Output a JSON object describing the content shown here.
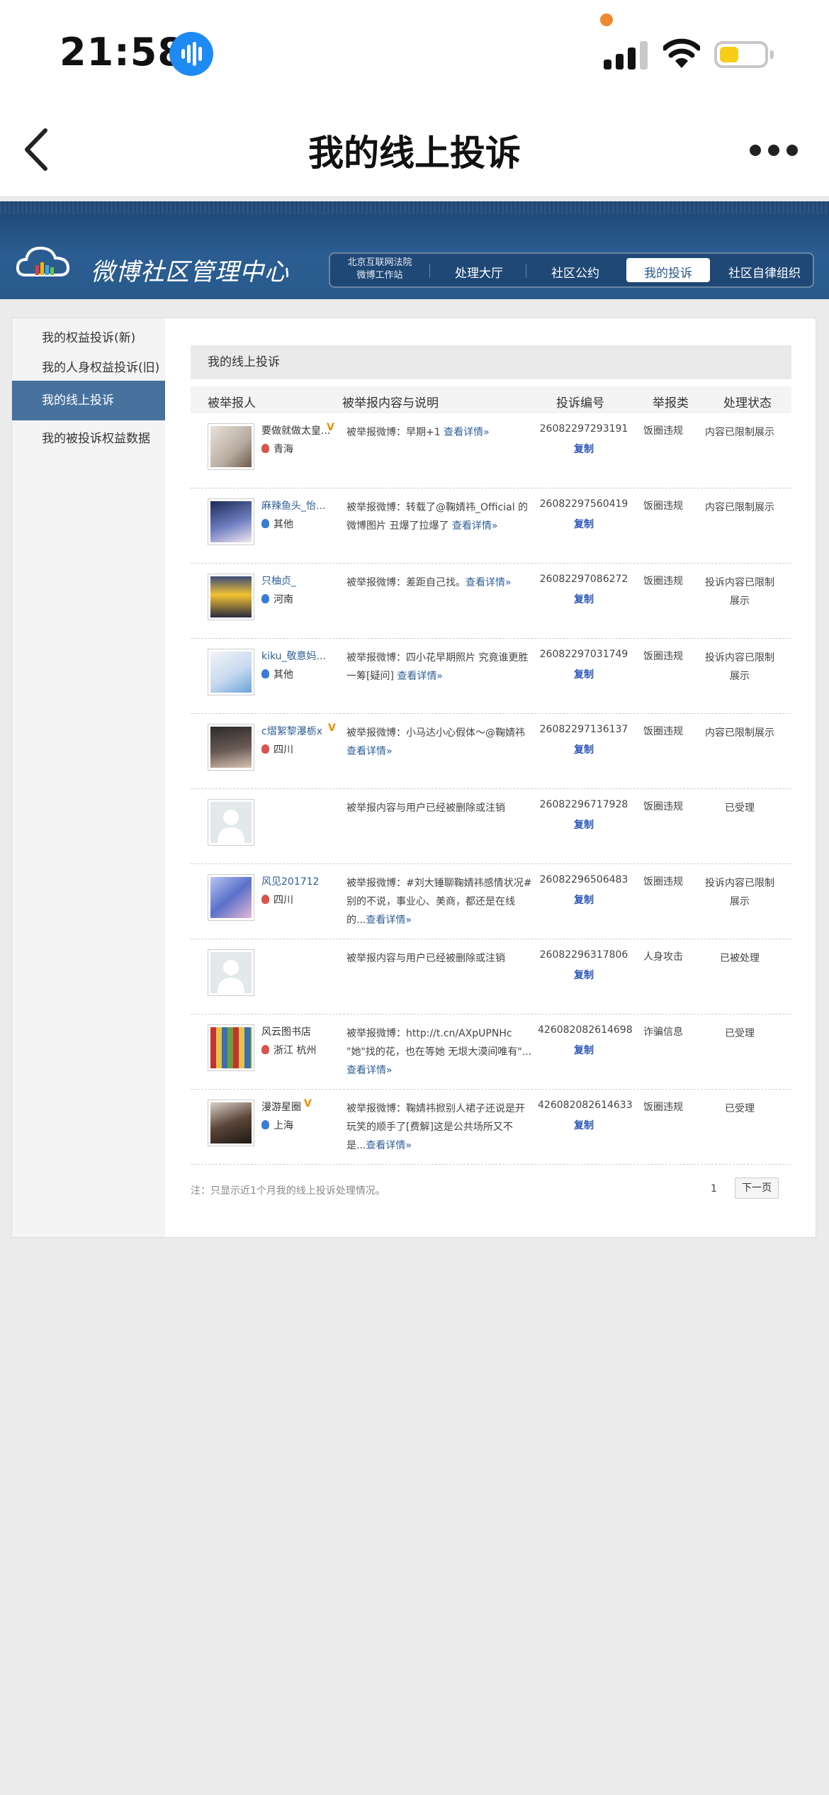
{
  "status_bar": {
    "time": "21:58"
  },
  "nav": {
    "title": "我的线上投诉"
  },
  "banner": {
    "logo_text": "微博社区管理中心",
    "court_line1": "北京互联网法院",
    "court_line2": "微博工作站",
    "menu": [
      "处理大厅",
      "社区公约",
      "我的投诉",
      "社区自律组织"
    ]
  },
  "sidebar": {
    "items": [
      "我的权益投诉(新)",
      "我的人身权益投诉(旧)",
      "我的线上投诉",
      "我的被投诉权益数据"
    ]
  },
  "main": {
    "section_title": "我的线上投诉",
    "columns": [
      "被举报人",
      "被举报内容与说明",
      "投诉编号",
      "举报类",
      "处理状态"
    ],
    "copy_label": "复制",
    "rows": [
      {
        "name": "要做就做太皇...",
        "location": "青海",
        "desc": "被举报微博：早期+1 ",
        "more": "查看详情»",
        "id": "26082297293191",
        "category": "饭圈违规",
        "status": "内容已限制展示"
      },
      {
        "name": "麻辣鱼头_怡...",
        "location": "其他",
        "desc": "被举报微博：转载了@鞠婧祎_Official 的微博图片 丑爆了拉爆了 ",
        "more": "查看详情»",
        "id": "26082297560419",
        "category": "饭圈违规",
        "status": "内容已限制展示"
      },
      {
        "name": "只柚贞_",
        "location": "河南",
        "desc": "被举报微博：差距自己找。",
        "more": "查看详情»",
        "id": "26082297086272",
        "category": "饭圈违规",
        "status": "投诉内容已限制展示"
      },
      {
        "name": "kiku_敬意妈...",
        "location": "其他",
        "desc": "被举报微博：四小花早期照片 究竟谁更胜一筹[疑问] ",
        "more": "查看详情»",
        "id": "26082297031749",
        "category": "饭圈违规",
        "status": "投诉内容已限制展示"
      },
      {
        "name": "c熠絮黎瀑栃x",
        "location": "四川",
        "desc": "被举报微博：小马达小心假体～@鞠婧祎 ",
        "more": "查看详情»",
        "id": "26082297136137",
        "category": "饭圈违规",
        "status": "内容已限制展示"
      },
      {
        "name": "",
        "location": "",
        "desc": "被举报内容与用户已经被删除或注销",
        "more": "",
        "id": "26082296717928",
        "category": "饭圈违规",
        "status": "已受理"
      },
      {
        "name": "风见201712",
        "location": "四川",
        "desc": "被举报微博：#刘大锤聊鞠婧祎感情状况#别的不说，事业心、美商，都还是在线的...",
        "more": "查看详情»",
        "id": "26082296506483",
        "category": "饭圈违规",
        "status": "投诉内容已限制展示"
      },
      {
        "name": "",
        "location": "",
        "desc": "被举报内容与用户已经被删除或注销",
        "more": "",
        "id": "26082296317806",
        "category": "人身攻击",
        "status": "已被处理"
      },
      {
        "name": "风云图书店",
        "location": "浙江 杭州",
        "desc": "被举报微博：http://t.cn/AXpUPNHc \"她\"找的花，也在等她 无垠大漠间唯有\"...",
        "more": "查看详情»",
        "id": "426082082614698",
        "category": "诈骗信息",
        "status": "已受理"
      },
      {
        "name": "漫游星圈",
        "location": "上海",
        "desc": "被举报微博：鞠婧祎掀别人裙子还说是开玩笑的顺手了[费解]这是公共场所又不是...",
        "more": "查看详情»",
        "id": "426082082614633",
        "category": "饭圈违规",
        "status": "已受理"
      }
    ],
    "note": "注：只显示近1个月我的线上投诉处理情况。",
    "page": "1",
    "next_label": "下一页"
  }
}
